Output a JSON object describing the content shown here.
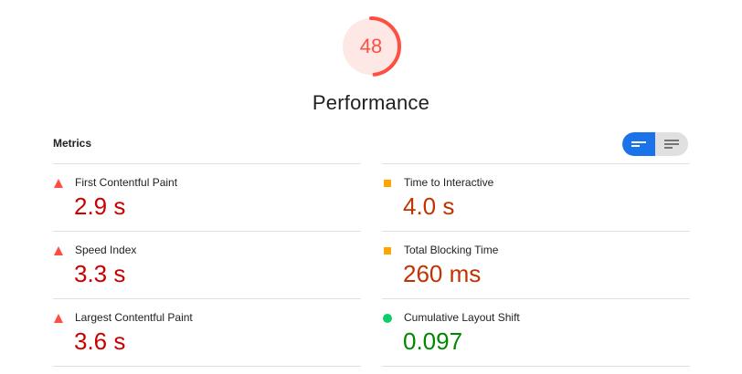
{
  "score": {
    "value": "48",
    "fraction": 0.48,
    "color": "#ff4e42",
    "track_color": "#fde8e6"
  },
  "title": "Performance",
  "metrics_heading": "Metrics",
  "view_toggle": {
    "selected": "list-view",
    "icons": [
      "list-compact-icon",
      "list-detailed-icon"
    ],
    "accent": "#1a73e8"
  },
  "metrics": [
    {
      "label": "First Contentful Paint",
      "value": "2.9 s",
      "status": "fail"
    },
    {
      "label": "Speed Index",
      "value": "3.3 s",
      "status": "fail"
    },
    {
      "label": "Largest Contentful Paint",
      "value": "3.6 s",
      "status": "fail"
    },
    {
      "label": "Time to Interactive",
      "value": "4.0 s",
      "status": "average"
    },
    {
      "label": "Total Blocking Time",
      "value": "260 ms",
      "status": "average"
    },
    {
      "label": "Cumulative Layout Shift",
      "value": "0.097",
      "status": "pass"
    }
  ],
  "status_colors": {
    "fail": {
      "icon": "#ff4e42",
      "text": "#cc0000"
    },
    "average": {
      "icon": "#ffa400",
      "text": "#c33300"
    },
    "pass": {
      "icon": "#0cce6b",
      "text": "#008800"
    }
  }
}
